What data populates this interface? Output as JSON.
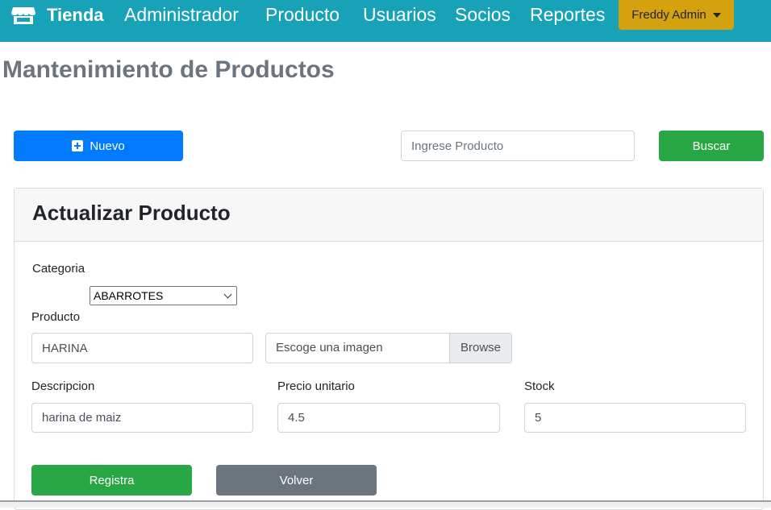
{
  "navbar": {
    "brand": "Tienda",
    "links": [
      "Administrador",
      "Producto",
      "Usuarios",
      "Socios",
      "Reportes"
    ],
    "user": "Freddy Admin",
    "bg_color": "#17a2b8",
    "user_color": "#d4a10f"
  },
  "page": {
    "title": "Mantenimiento de Productos"
  },
  "toolbar": {
    "new_label": "Nuevo",
    "search_placeholder": "Ingrese Producto",
    "search_label": "Buscar"
  },
  "form": {
    "title": "Actualizar Producto",
    "category_label": "Categoria",
    "category_value": "ABARROTES",
    "product_label": "Producto",
    "product_value": "HARINA",
    "image_placeholder": "Escoge una imagen",
    "browse_label": "Browse",
    "description_label": "Descripcion",
    "description_value": "harina de maiz",
    "price_label": "Precio unitario",
    "price_value": "4.5",
    "stock_label": "Stock",
    "stock_value": "5",
    "save_label": "Registra",
    "back_label": "Volver"
  }
}
